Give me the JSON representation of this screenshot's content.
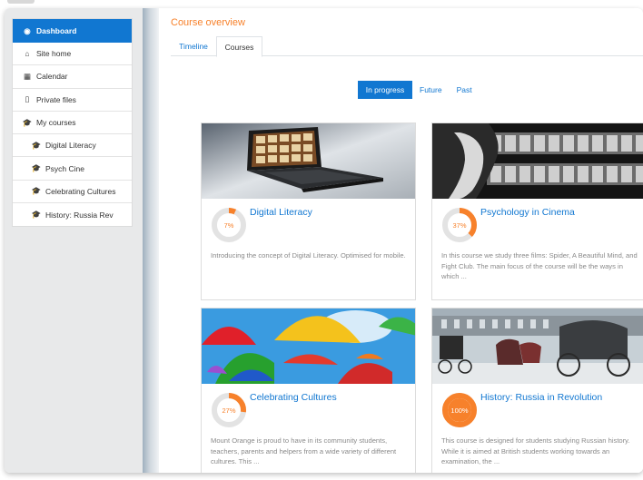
{
  "sidebar": {
    "items": [
      {
        "label": "Dashboard",
        "icon": "dashboard-icon",
        "glyph": "◉"
      },
      {
        "label": "Site home",
        "icon": "home-icon",
        "glyph": "⌂"
      },
      {
        "label": "Calendar",
        "icon": "calendar-icon",
        "glyph": "▦"
      },
      {
        "label": "Private files",
        "icon": "file-icon",
        "glyph": "▯"
      },
      {
        "label": "My courses",
        "icon": "graduation-cap-icon",
        "glyph": "🎓"
      },
      {
        "label": "Digital Literacy",
        "icon": "graduation-cap-icon",
        "glyph": "🎓"
      },
      {
        "label": "Psych Cine",
        "icon": "graduation-cap-icon",
        "glyph": "🎓"
      },
      {
        "label": "Celebrating Cultures",
        "icon": "graduation-cap-icon",
        "glyph": "🎓"
      },
      {
        "label": "History: Russia Rev",
        "icon": "graduation-cap-icon",
        "glyph": "🎓"
      }
    ]
  },
  "main": {
    "title": "Course overview",
    "tabs": [
      "Timeline",
      "Courses"
    ],
    "active_tab": "Courses",
    "filters": [
      "In progress",
      "Future",
      "Past"
    ],
    "active_filter": "In progress"
  },
  "courses": [
    {
      "title": "Digital Literacy",
      "progress": 7,
      "progress_label": "7%",
      "description": "Introducing the concept of Digital Literacy. Optimised for mobile."
    },
    {
      "title": "Psychology in Cinema",
      "progress": 37,
      "progress_label": "37%",
      "description": "In this course we study three films: Spider, A Beautiful Mind, and Fight Club. The main focus of the course will be the ways in which ..."
    },
    {
      "title": "Celebrating Cultures",
      "progress": 27,
      "progress_label": "27%",
      "description": "Mount Orange is proud to have in its community students, teachers, parents and helpers from a wide variety of different cultures. This ..."
    },
    {
      "title": "History: Russia in Revolution",
      "progress": 100,
      "progress_label": "100%",
      "description": "This course is designed for students studying Russian history. While it is aimed at British students working towards an examination, the ..."
    }
  ],
  "colors": {
    "accent": "#1177d1",
    "orange": "#f7812b",
    "ring_track": "#e3e3e3"
  }
}
